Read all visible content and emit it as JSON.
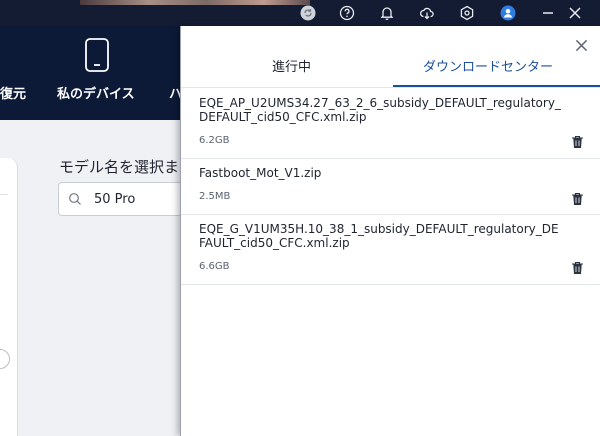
{
  "app_nav": {
    "items": [
      {
        "label": "復元"
      },
      {
        "label": "私のデバイス"
      },
      {
        "label": "ハ"
      }
    ]
  },
  "content": {
    "model_label": "モデル名を選択ま",
    "search_value": "50 Pro"
  },
  "download_panel": {
    "tabs": [
      {
        "label": "進行中",
        "active": false
      },
      {
        "label": "ダウンロードセンター",
        "active": true
      }
    ],
    "files": [
      {
        "name": "EQE_AP_U2UMS34.27_63_2_6_subsidy_DEFAULT_regulatory_DEFAULT_cid50_CFC.xml.zip",
        "size": "6.2GB"
      },
      {
        "name": "Fastboot_Mot_V1.zip",
        "size": "2.5MB"
      },
      {
        "name": "EQE_G_V1UM35H.10_38_1_subsidy_DEFAULT_regulatory_DEFAULT_cid50_CFC.xml.zip",
        "size": "6.6GB"
      }
    ]
  },
  "colors": {
    "nav_bg": "#0d1a37",
    "accent": "#1b4f9c",
    "avatar_blue": "#2f7de1"
  }
}
